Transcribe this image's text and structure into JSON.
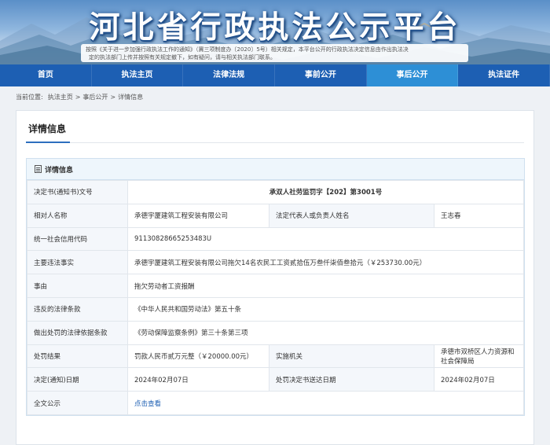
{
  "banner": {
    "title": "河北省行政执法公示平台",
    "notice_line1": "按照《关于进一步加强行政执法工作的通知》（冀三项制度办〔2020〕5号）相关规定，本平台公开的行政执法决定信息由作出执法决",
    "notice_line2": "定的执法部门上传并按照有关规定撤下，如有疑问，请与相关执法部门联系。"
  },
  "nav": {
    "items": [
      {
        "label": "首页"
      },
      {
        "label": "执法主页"
      },
      {
        "label": "法律法规"
      },
      {
        "label": "事前公开"
      },
      {
        "label": "事后公开",
        "active": true
      },
      {
        "label": "执法证件"
      }
    ]
  },
  "breadcrumb": {
    "prefix": "当前位置:",
    "items": [
      "执法主页",
      "事后公开",
      "详情信息"
    ],
    "separator": ">"
  },
  "panel": {
    "title": "详情信息",
    "section_title": "详情信息"
  },
  "detail": {
    "doc_no_label": "决定书(通知书)文号",
    "doc_no_value": "承双人社劳监罚字【202】第3001号",
    "party_label": "相对人名称",
    "party_value": "承德宇厦建筑工程安装有限公司",
    "legal_rep_label": "法定代表人或负责人姓名",
    "legal_rep_value": "王志春",
    "credit_code_label": "统一社会信用代码",
    "credit_code_value": "91130828665253483U",
    "facts_label": "主要违法事实",
    "facts_value": "承德宇厦建筑工程安装有限公司拖欠14名农民工工资贰拾伍万叁仟柒佰叁拾元（￥253730.00元）",
    "cause_label": "事由",
    "cause_value": "拖欠劳动者工资报酬",
    "violated_law_label": "违反的法律条款",
    "violated_law_value": "《中华人民共和国劳动法》第五十条",
    "basis_label": "做出处罚的法律依据条款",
    "basis_value": "《劳动保障监察条例》第三十条第三项",
    "result_label": "处罚结果",
    "result_value": "罚款人民币贰万元整（￥20000.00元）",
    "agency_label": "实施机关",
    "agency_value": "承德市双桥区人力资源和社会保障局",
    "decision_date_label": "决定(通知)日期",
    "decision_date_value": "2024年02月07日",
    "delivery_date_label": "处罚决定书送达日期",
    "delivery_date_value": "2024年02月07日",
    "fulltext_label": "全文公示",
    "fulltext_link": "点击查看"
  }
}
